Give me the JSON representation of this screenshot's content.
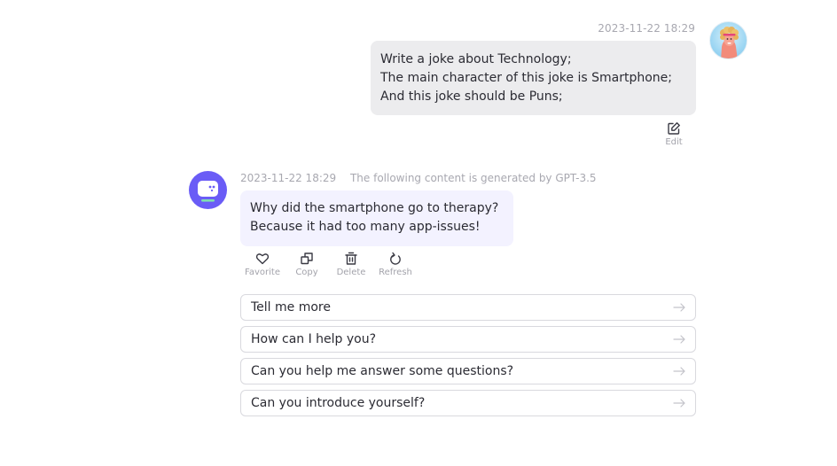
{
  "user_message": {
    "timestamp": "2023-11-22 18:29",
    "lines": [
      "Write a joke about Technology;",
      "The main character of this joke is Smartphone;",
      "And this joke should be Puns;"
    ],
    "avatar_icon": "user-avatar-icon",
    "actions": [
      {
        "label": "Edit",
        "icon": "edit-icon"
      }
    ]
  },
  "bot_message": {
    "timestamp": "2023-11-22 18:29",
    "generated_by": "The following content is generated by GPT-3.5",
    "lines": [
      "Why did the smartphone go to therapy?",
      "Because it had too many app-issues!"
    ],
    "avatar_icon": "bot-avatar-icon",
    "actions": [
      {
        "label": "Favorite",
        "icon": "heart-icon"
      },
      {
        "label": "Copy",
        "icon": "copy-icon"
      },
      {
        "label": "Delete",
        "icon": "trash-icon"
      },
      {
        "label": "Refresh",
        "icon": "refresh-icon"
      }
    ]
  },
  "suggestions": [
    {
      "text": "Tell me more",
      "icon": "arrow-right-icon"
    },
    {
      "text": "How can I help you?",
      "icon": "arrow-right-icon"
    },
    {
      "text": "Can you help me answer some questions?",
      "icon": "arrow-right-icon"
    },
    {
      "text": "Can you introduce yourself?",
      "icon": "arrow-right-icon"
    }
  ],
  "colors": {
    "bot_avatar_bg": "#6a5cf6",
    "bot_bubble_bg": "#f3f2ff",
    "user_bubble_bg": "#ececee",
    "muted_text": "#a8a8b0",
    "accent_green": "#7fe0b0"
  }
}
